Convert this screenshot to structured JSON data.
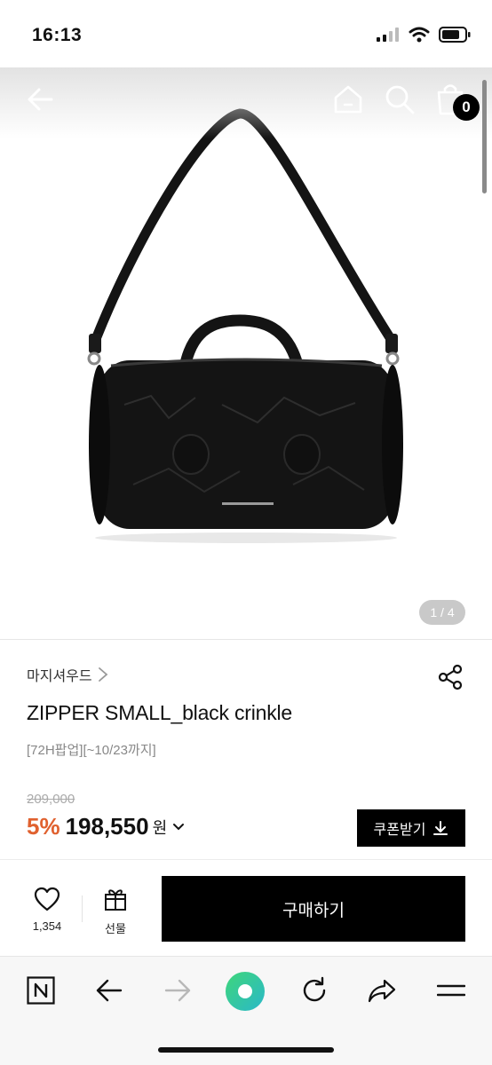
{
  "status_bar": {
    "time": "16:13"
  },
  "header": {
    "cart_count": "0"
  },
  "gallery": {
    "pager": "1 / 4"
  },
  "product": {
    "brand": "마지셔우드",
    "title": "ZIPPER SMALL_black crinkle",
    "subtitle": "[72H팝업][~10/23까지]",
    "original_price": "209,000",
    "discount": "5%",
    "price": "198,550",
    "currency": "원"
  },
  "coupon": {
    "label": "쿠폰받기"
  },
  "purchase_bar": {
    "like_count": "1,354",
    "gift_label": "선물",
    "buy_label": "구매하기"
  },
  "colors": {
    "discount": "#e0612f",
    "primary": "#000000",
    "browser_home": "#4cd964"
  }
}
